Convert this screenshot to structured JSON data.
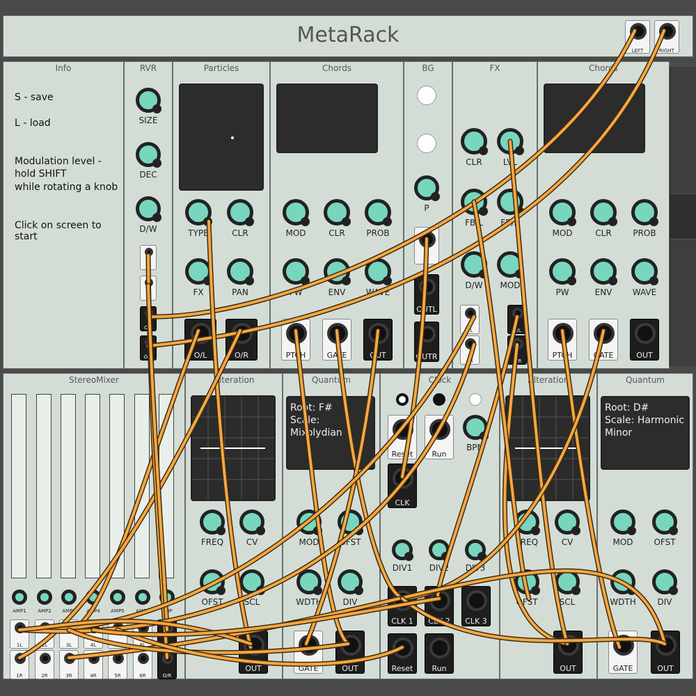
{
  "app": {
    "title": "MetaRack",
    "header_outputs": [
      "LEFT",
      "RIGHT"
    ]
  },
  "info": {
    "title": "Info",
    "lines": [
      "S - save",
      "L - load",
      "Modulation level -",
      "hold SHIFT",
      "while rotating a knob",
      "Click on screen to start"
    ]
  },
  "reverb": {
    "title": "RVR",
    "knobs": [
      "SIZE",
      "DEC",
      "D/W"
    ],
    "jacks": [
      "",
      "",
      "O/L",
      "O/R"
    ]
  },
  "particles": {
    "title": "Particles",
    "knobs": [
      "TYPE",
      "CLR",
      "FX",
      "PAN"
    ],
    "outputs": [
      "O/L",
      "O/R"
    ]
  },
  "chords1": {
    "title": "Chords",
    "knobs": [
      "MOD",
      "CLR",
      "PROB",
      "PW",
      "ENV",
      "WAVE"
    ],
    "jacks": [
      "PTCH",
      "GATE",
      "OUT"
    ]
  },
  "bg": {
    "title": "BG",
    "knob": "P",
    "jacks": [
      "I",
      "OUTL",
      "OUTR"
    ]
  },
  "fx": {
    "title": "FX",
    "knobs": [
      "CLR",
      "LVL",
      "FB/L",
      "FB/R",
      "D/W",
      "MOD"
    ],
    "jacks": [
      "I/L",
      "I/R",
      "O/L",
      "O/R"
    ]
  },
  "chords2": {
    "title": "Chords",
    "knobs": [
      "MOD",
      "CLR",
      "PROB",
      "PW",
      "ENV",
      "WAVE"
    ],
    "jacks": [
      "PTCH",
      "GATE",
      "OUT"
    ]
  },
  "stereomixer": {
    "title": "StereoMixer",
    "amps": [
      "AMP1",
      "AMP2",
      "AMP3",
      "AMP4",
      "AMP5",
      "AMP6",
      "AMP"
    ],
    "left_inputs": [
      "1L",
      "2L",
      "3L",
      "4L",
      "5L",
      "6L",
      "O/L"
    ],
    "right_inputs": [
      "1R",
      "2R",
      "3R",
      "4R",
      "5R",
      "6R",
      "O/R"
    ]
  },
  "alteration1": {
    "title": "Alteration",
    "knobs": [
      "FREQ",
      "CV",
      "OFST",
      "SCL"
    ],
    "output": "OUT"
  },
  "quantum1": {
    "title": "Quantum",
    "screen": [
      "Root: F#",
      "Scale: Mixolydian"
    ],
    "knobs": [
      "MOD",
      "OFST",
      "WDTH",
      "DIV"
    ],
    "jacks": [
      "GATE",
      "OUT"
    ]
  },
  "clock": {
    "title": "Clock",
    "buttons": [
      "Reset",
      "Run"
    ],
    "knob": "BPM",
    "clk_label": "CLK",
    "div_knobs": [
      "DIV1",
      "DIV2",
      "DIV3"
    ],
    "outputs": [
      "CLK 1",
      "CLK 2",
      "CLK 3"
    ],
    "bottom_jacks": [
      "Reset",
      "Run"
    ]
  },
  "alteration2": {
    "title": "Alteration",
    "knobs": [
      "FREQ",
      "CV",
      "OFST",
      "SCL"
    ],
    "output": "OUT"
  },
  "quantum2": {
    "title": "Quantum",
    "screen": [
      "Root: D#",
      "Scale: Harmonic",
      "Minor"
    ],
    "knobs": [
      "MOD",
      "OFST",
      "WDTH",
      "DIV"
    ],
    "jacks": [
      "GATE",
      "OUT"
    ]
  },
  "colors": {
    "panel": "#d3ddd6",
    "knob": "#78d6bf",
    "cable": "#f5a742",
    "rack": "#4a4a4a"
  }
}
